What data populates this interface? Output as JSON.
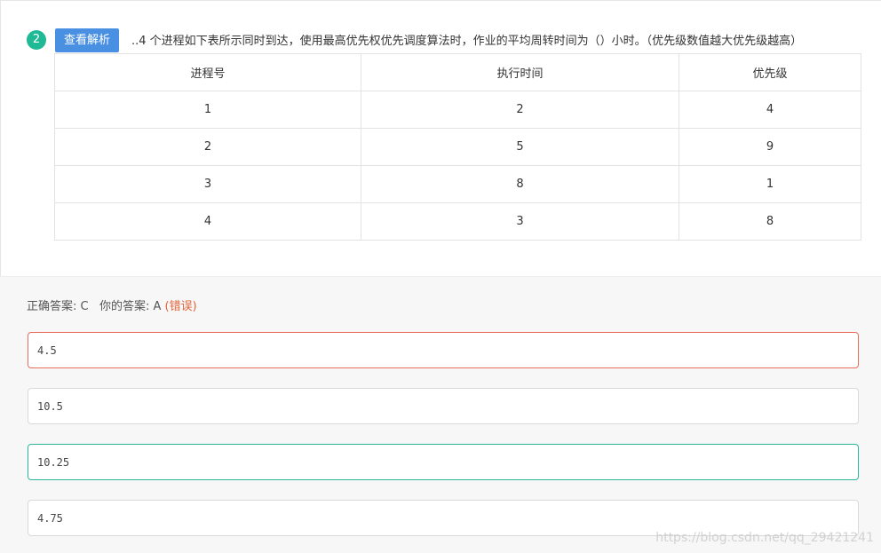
{
  "question": {
    "number": "2",
    "analysis_button": "查看解析",
    "text": "..4 个进程如下表所示同时到达，使用最高优先权优先调度算法时，作业的平均周转时间为（）小时。（优先级数值越大优先级越高）",
    "table": {
      "headers": [
        "进程号",
        "执行时间",
        "优先级"
      ],
      "rows": [
        [
          "1",
          "2",
          "4"
        ],
        [
          "2",
          "5",
          "9"
        ],
        [
          "3",
          "8",
          "1"
        ],
        [
          "4",
          "3",
          "8"
        ]
      ]
    }
  },
  "answer": {
    "correct_label": "正确答案: C",
    "your_label": "你的答案: A",
    "status": "(错误)",
    "status_color": "#e2643b"
  },
  "options": [
    {
      "value": "4.5",
      "state": "wrong"
    },
    {
      "value": "10.5",
      "state": "normal"
    },
    {
      "value": "10.25",
      "state": "correct"
    },
    {
      "value": "4.75",
      "state": "normal"
    }
  ],
  "watermark": "https://blog.csdn.net/qq_29421241",
  "colors": {
    "accent_blue": "#4a90e2",
    "correct_green": "#2bb89a",
    "wrong_red": "#ea6d5a"
  }
}
